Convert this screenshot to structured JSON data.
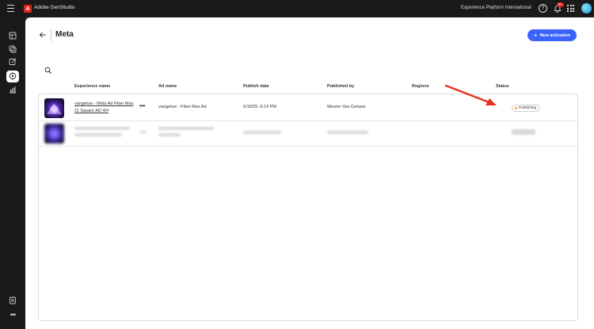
{
  "app": {
    "name": "Adobe GenStudio",
    "org": "Experience Platform International",
    "notification_count": "9+"
  },
  "page": {
    "title": "Meta",
    "new_button_label": "New activation"
  },
  "table": {
    "columns": [
      "Experience name",
      "Ad name",
      "Publish date",
      "Published by",
      "Regions",
      "Status"
    ],
    "rows": [
      {
        "experience_name": "vangeluw - Meta Ad Fiber Max 11 Square AD 4/4",
        "ad_name": "vangeluw - Fiber Max Ad",
        "publish_date": "6/19/25, 6:14 PM",
        "published_by": "Wouter Van Geluwe",
        "regions": "",
        "status": "Publishing",
        "status_color": "#e8a628"
      }
    ]
  },
  "colors": {
    "accent": "#3b63fb",
    "annotation_arrow": "#e8321e"
  },
  "icons": [
    "hamburger-icon",
    "adobe-logo-icon",
    "help-icon",
    "bell-icon",
    "apps-grid-icon",
    "back-arrow-icon",
    "search-icon",
    "more-icon",
    "plus-icon"
  ]
}
